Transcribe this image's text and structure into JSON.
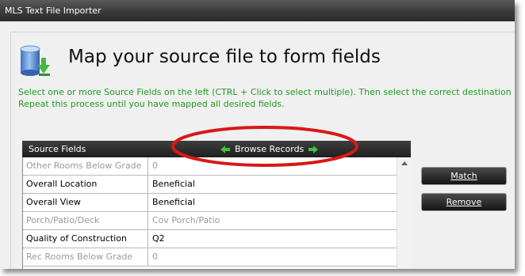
{
  "window": {
    "title": "MLS Text File Importer"
  },
  "page": {
    "heading": "Map your source file to form fields",
    "instructions_line1": "Select one or more Source Fields on the left (CTRL + Click to select multiple).  Then select the correct destination",
    "instructions_line2": "Repeat this process until you have mapped all desired fields."
  },
  "grid": {
    "header": "Source Fields",
    "browse_label": "Browse Records",
    "rows": [
      {
        "field": "Other Rooms Below Grade",
        "value": "0",
        "active": false
      },
      {
        "field": "Overall Location",
        "value": "Beneficial",
        "active": true
      },
      {
        "field": "Overall View",
        "value": "Beneficial",
        "active": true
      },
      {
        "field": "Porch/Patio/Deck",
        "value": "Cov Porch/Patio",
        "active": false
      },
      {
        "field": "Quality of Construction",
        "value": "Q2",
        "active": true
      },
      {
        "field": "Rec Rooms Below Grade",
        "value": "0",
        "active": false
      }
    ]
  },
  "buttons": {
    "match": "Match",
    "remove": "Remove"
  },
  "colors": {
    "instruction_text": "#1f9a1f",
    "arrow_green": "#3cc43c",
    "highlight_ring": "#d81818"
  }
}
